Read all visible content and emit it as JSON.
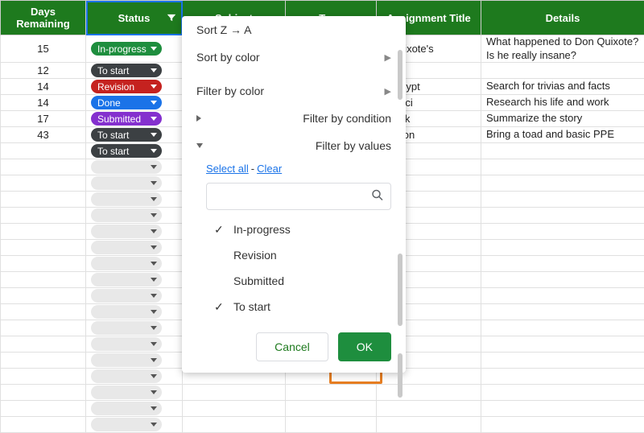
{
  "columns": {
    "days": "Days Remaining",
    "status": "Status",
    "subject": "Subject",
    "type": "Type",
    "assignment": "Assignment Title",
    "details": "Details"
  },
  "rows": [
    {
      "days": "15",
      "status": {
        "label": "In-progress",
        "color": "#1e8e3e"
      },
      "assignment": "n Quixote's",
      "details": "What happened to Don Quixote? Is he really insane?"
    },
    {
      "days": "12",
      "status": {
        "label": "To start",
        "color": "#3c4043"
      },
      "assignment": "",
      "details": ""
    },
    {
      "days": "14",
      "status": {
        "label": "Revision",
        "color": "#c5221f"
      },
      "assignment": "ut Egypt",
      "details": "Search for trivias and facts"
    },
    {
      "days": "14",
      "status": {
        "label": "Done",
        "color": "#1a73e8"
      },
      "assignment": "a Vinci",
      "details": "Research his life and work"
    },
    {
      "days": "17",
      "status": {
        "label": "Submitted",
        "color": "#8430ce"
      },
      "assignment": "ebook",
      "details": "Summarize the story"
    },
    {
      "days": "43",
      "status": {
        "label": "To start",
        "color": "#3c4043"
      },
      "assignment": "section",
      "details": "Bring a toad and basic PPE"
    },
    {
      "days": "",
      "status": {
        "label": "To start",
        "color": "#3c4043"
      },
      "assignment": "",
      "details": ""
    }
  ],
  "filter_menu": {
    "sort_za": "Sort Z → A",
    "sort_color": "Sort by color",
    "filter_color": "Filter by color",
    "filter_condition": "Filter by condition",
    "filter_values": "Filter by values",
    "select_all": "Select all",
    "clear": "Clear",
    "search_placeholder": "",
    "values": [
      {
        "label": "In-progress",
        "checked": true
      },
      {
        "label": "Revision",
        "checked": false
      },
      {
        "label": "Submitted",
        "checked": false
      },
      {
        "label": "To start",
        "checked": true
      }
    ],
    "cancel": "Cancel",
    "ok": "OK"
  }
}
